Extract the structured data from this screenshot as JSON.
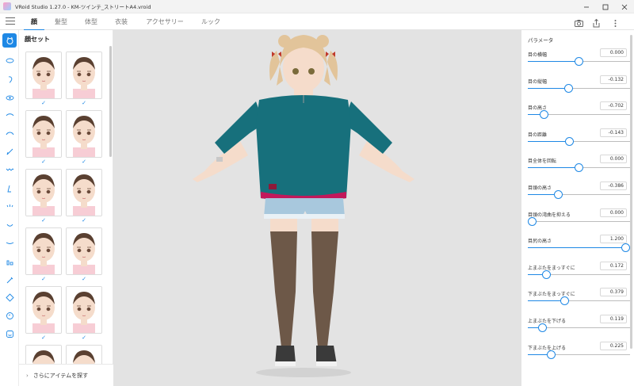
{
  "window": {
    "title": "VRoid Studio 1.27.0 - KM-ツインテ_ストリートA4.vroid"
  },
  "tabs": [
    {
      "label": "顔"
    },
    {
      "label": "髪型"
    },
    {
      "label": "体型"
    },
    {
      "label": "衣装"
    },
    {
      "label": "アクセサリー"
    },
    {
      "label": "ルック"
    }
  ],
  "toolbar_icons": [
    "camera-icon",
    "share-icon",
    "more-vert-icon"
  ],
  "rail_icons": [
    "face-set-icon",
    "eye-shape-icon",
    "ear-icon",
    "eye-icon",
    "eyelash-icon",
    "eyebrow-icon",
    "brow-line-icon",
    "eyelid-line-icon",
    "lash-icon",
    "nose-icon",
    "mouth-icon",
    "teeth-icon",
    "neck-icon",
    "lipstick-icon",
    "face-outline-icon",
    "ear-shape-icon",
    "smile-icon"
  ],
  "preset_panel": {
    "title": "顔セット",
    "more_label": "さらにアイテムを探す",
    "presets": [
      {
        "checked": true
      },
      {
        "checked": true
      },
      {
        "checked": true
      },
      {
        "checked": true
      },
      {
        "checked": true
      },
      {
        "checked": true
      },
      {
        "checked": true
      },
      {
        "checked": true
      },
      {
        "checked": true
      },
      {
        "checked": true
      },
      {
        "checked": false
      },
      {
        "checked": false
      }
    ]
  },
  "params": {
    "header": "パラメータ",
    "items": [
      {
        "label": "目の横幅",
        "value": "0.000",
        "level": 0.5
      },
      {
        "label": "目の縦幅",
        "value": "-0.132",
        "level": 0.39
      },
      {
        "label": "目の高さ",
        "value": "-0.702",
        "level": 0.13
      },
      {
        "label": "目の距離",
        "value": "-0.143",
        "level": 0.4
      },
      {
        "label": "目全体を回転",
        "value": "0.000",
        "level": 0.5
      },
      {
        "label": "目頭の高さ",
        "value": "-0.386",
        "level": 0.28
      },
      {
        "label": "目頭の湾曲を抑える",
        "value": "0.000",
        "level": 0.0
      },
      {
        "label": "目尻の高さ",
        "value": "1.200",
        "level": 1.0
      },
      {
        "label": "上まぶたをまっすぐに",
        "value": "0.172",
        "level": 0.15
      },
      {
        "label": "下まぶたをまっすぐに",
        "value": "0.379",
        "level": 0.35
      },
      {
        "label": "上まぶたを下げる",
        "value": "0.119",
        "level": 0.11
      },
      {
        "label": "下まぶたを上げる",
        "value": "0.225",
        "level": 0.2
      }
    ]
  },
  "colors": {
    "accent": "#1e88e5",
    "viewport_bg": "#e3e3e3",
    "shirt": "#17707c",
    "hair": "#e2c49a"
  }
}
